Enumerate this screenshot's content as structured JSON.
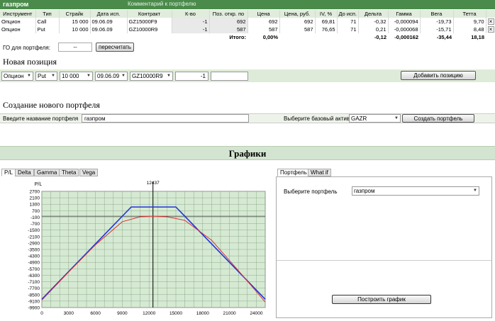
{
  "header": {
    "title": "газпром",
    "comment": "Комментарий к портфелю"
  },
  "portfolio": {
    "columns": [
      "Инструмент",
      "Тип",
      "Страйк",
      "Дата исп.",
      "Контракт",
      "К-во",
      "Поз. откр. по",
      "Цена",
      "Цена, руб.",
      "IV, %",
      "До исп.",
      "Дельта",
      "Гамма",
      "Вега",
      "Тетта"
    ],
    "rows": [
      [
        "Опцион",
        "Call",
        "15 000",
        "09.06.09",
        "GZ15000F9",
        "-1",
        "692",
        "692",
        "692",
        "69,81",
        "71",
        "-0,32",
        "-0,000094",
        "-19,73",
        "9,70"
      ],
      [
        "Опцион",
        "Put",
        "10 000",
        "09.06.09",
        "GZ10000R9",
        "-1",
        "587",
        "587",
        "587",
        "76,65",
        "71",
        "0,21",
        "-0,000068",
        "-15,71",
        "8,48"
      ]
    ],
    "totals": {
      "label": "Итого:",
      "price": "0,00%",
      "delta": "-0,12",
      "gamma": "-0,000162",
      "vega": "-35,44",
      "theta": "18,18"
    },
    "delete_glyph": "×"
  },
  "go": {
    "label": "ГО для портфеля:",
    "value": "--",
    "recalc": "пересчитать"
  },
  "new_position": {
    "title": "Новая позиция",
    "instrument": "Опцион",
    "type": "Put",
    "strike": "10 000",
    "date": "09.06.09",
    "contract": "GZ10000R9",
    "qty": "-1",
    "price": "",
    "add": "Добавить позицию"
  },
  "create": {
    "title": "Создание нового портфеля",
    "name_label": "Введите название портфеля",
    "name_value": "газпром",
    "asset_label": "Выберите базовый актив",
    "asset_value": "GAZR",
    "create_btn": "Создать портфель"
  },
  "graphs": {
    "title": "Графики",
    "tabs": [
      "P/L",
      "Delta",
      "Gamma",
      "Theta",
      "Vega"
    ],
    "right_tabs": [
      "Портфель",
      "What if"
    ],
    "select_label": "Выберите портфель",
    "select_value": "газпром",
    "build": "Построить график"
  },
  "chart_data": {
    "type": "line",
    "ylabel": "P/L",
    "marker_label": "12437",
    "marker_x": 12437,
    "xlim": [
      0,
      25000
    ],
    "ylim": [
      -9900,
      2700
    ],
    "x_ticks": [
      "0",
      "3000",
      "6000",
      "9000",
      "12000",
      "15000",
      "18000",
      "21000",
      "24000"
    ],
    "y_ticks": [
      "2700",
      "2100",
      "1300",
      "700",
      "-100",
      "-700",
      "-1500",
      "-2100",
      "-2900",
      "-3500",
      "-4300",
      "-4900",
      "-5700",
      "-6300",
      "-7100",
      "-7700",
      "-8500",
      "-9100",
      "-9900"
    ],
    "series": [
      {
        "color": "#2233dd",
        "x": [
          0,
          10000,
          15000,
          25000
        ],
        "y": [
          -9000,
          1000,
          1000,
          -9000
        ]
      },
      {
        "color": "#dd3333",
        "x": [
          0,
          3000,
          6000,
          9000,
          11000,
          12437,
          14000,
          16000,
          19000,
          22000,
          25000
        ],
        "y": [
          -9100,
          -6050,
          -3100,
          -600,
          -60,
          0,
          -60,
          -450,
          -2600,
          -5900,
          -9300
        ]
      }
    ]
  }
}
